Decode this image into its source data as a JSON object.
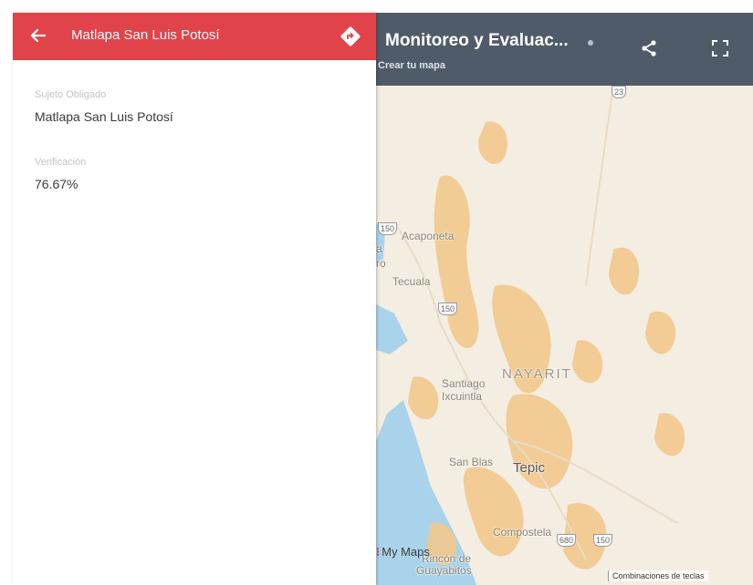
{
  "panel": {
    "title": "Matlapa San Luis Potosí",
    "fields": [
      {
        "label": "Sujeto Obligado",
        "value": "Matlapa San Luis Potosí"
      },
      {
        "label": "Verificación",
        "value": "76.67%"
      }
    ]
  },
  "map": {
    "title": "Monitoreo y Evaluac...",
    "subtitle": "Crear tu mapa",
    "labels": {
      "acaponeta": "Acaponeta",
      "tecuala": "Tecuala",
      "nayarit": "NAYARIT",
      "santiago_1": "Santiago",
      "santiago_2": "Ixcuintla",
      "san_blas": "San Blas",
      "tepic": "Tepic",
      "compostela": "Compostela",
      "rincon_1": "Rincón de",
      "rincon_2": "Guayabitos",
      "fragment_a": "a",
      "fragment_b": "ro"
    },
    "routes": {
      "r23": "23",
      "r150a": "150",
      "r150b": "150",
      "r150c": "150",
      "r680": "680"
    },
    "mymaps": "My Maps",
    "shortcuts": "Combinaciones de teclas"
  },
  "colors": {
    "header_red": "#e1434a",
    "map_bar": "#4f5b69",
    "land": "#f4ede1",
    "urban": "#f2c88d",
    "water": "#a9d3ea"
  }
}
